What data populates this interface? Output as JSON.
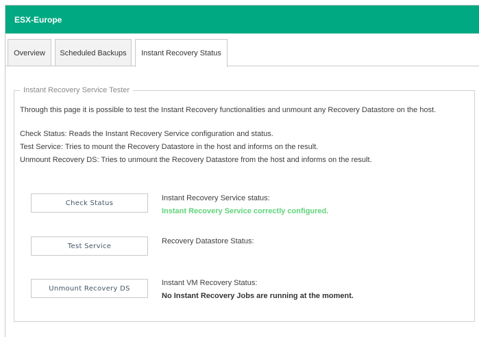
{
  "window": {
    "title": "ESX-Europe"
  },
  "tabs": [
    {
      "label": "Overview",
      "active": false
    },
    {
      "label": "Scheduled Backups",
      "active": false
    },
    {
      "label": "Instant Recovery Status",
      "active": true
    }
  ],
  "section": {
    "legend": "Instant Recovery Service Tester",
    "intro": "Through this page it is possible to test the Instant Recovery functionalities and unmount any Recovery Datastore on the host.",
    "help": [
      "Check Status: Reads the Instant Recovery Service configuration and status.",
      "Test Service: Tries to mount the Recovery Datastore in the host and informs on the result.",
      "Unmount Recovery DS: Tries to unmount the Recovery Datastore from the host and informs on the result."
    ]
  },
  "actions": [
    {
      "button": "Check Status",
      "status_label": "Instant Recovery Service status:",
      "status_value": "Instant Recovery Service correctly configured."
    },
    {
      "button": "Test Service",
      "status_label": "Recovery Datastore Status:",
      "status_value": ""
    },
    {
      "button": "Unmount Recovery DS",
      "status_label": "Instant VM Recovery Status:",
      "status_value": "No Instant Recovery Jobs are running at the moment."
    }
  ],
  "colors": {
    "titlebar": "#01a982",
    "success_text": "#5fd47a",
    "button_text": "#425563"
  }
}
